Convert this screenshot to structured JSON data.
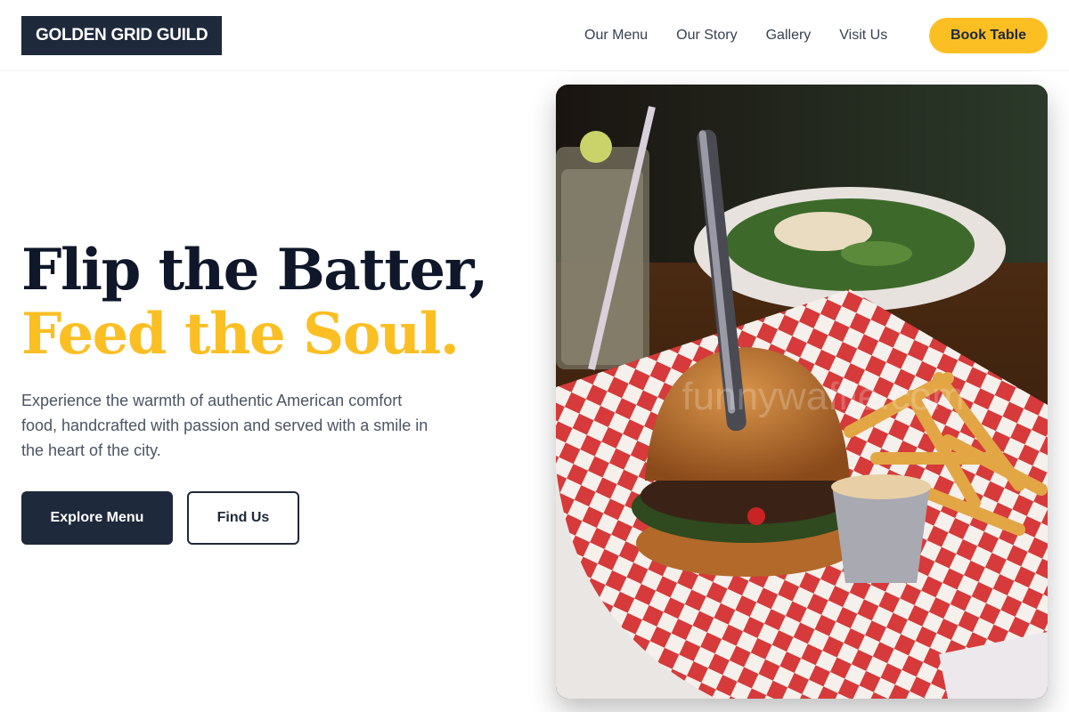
{
  "header": {
    "logo": "GOLDEN GRID GUILD",
    "nav": [
      "Our Menu",
      "Our Story",
      "Gallery",
      "Visit Us"
    ],
    "cta": "Book Table"
  },
  "hero": {
    "title_line1": "Flip the Batter,",
    "title_line2": "Feed the Soul.",
    "description": "Experience the warmth of authentic American comfort food, handcrafted with passion and served with a smile in the heart of the city.",
    "primary_button": "Explore Menu",
    "secondary_button": "Find Us",
    "image_watermark": "funnywaffle.com"
  },
  "colors": {
    "navy": "#1e293b",
    "accent": "#fbbf24",
    "text": "#4b5563"
  }
}
